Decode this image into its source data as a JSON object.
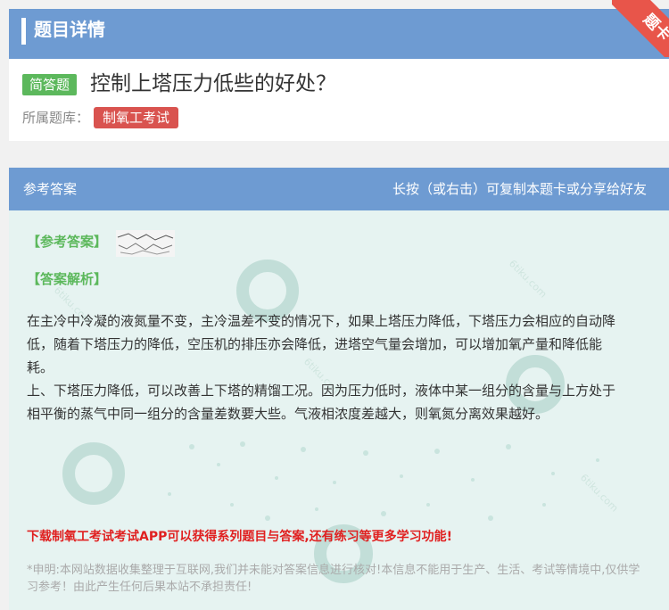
{
  "header": {
    "title": "题目详情"
  },
  "corner_badge": {
    "label": "题卡"
  },
  "question": {
    "type_badge": "简答题",
    "title": "控制上塔压力低些的好处？",
    "bank_label": "所属题库：",
    "bank_tag": "制氧工考试"
  },
  "answer_section": {
    "header_left": "参考答案",
    "header_right": "长按（或右击）可复制本题卡或分享给好友",
    "ref_answer_label": "【参考答案】",
    "analysis_label": "【答案解析】",
    "analysis_paragraphs": [
      "在主冷中冷凝的液氮量不变，主冷温差不变的情况下，如果上塔压力降低，下塔压力会相应的自动降低，随着下塔压力的降低，空压机的排压亦会降低，进塔空气量会增加，可以增加氧产量和降低能耗。",
      "上、下塔压力降低，可以改善上下塔的精馏工况。因为压力低时，液体中某一组分的含量与上方处于相平衡的蒸气中同一组分的含量差数要大些。气液相浓度差越大，则氧氮分离效果越好。"
    ]
  },
  "promo": {
    "text": "下载制氧工考试考试APP可以获得系列题目与答案,还有练习等更多学习功能!"
  },
  "disclaimer": {
    "text": "*申明:本网站数据收集整理于互联网,我们并未能对答案信息进行核对!本信息不能用于生产、生活、考试等情境中,仅供学习参考！由此产生任何后果本站不承担责任!"
  },
  "colors": {
    "header_blue": "#6e9bd2",
    "badge_green": "#5cb85c",
    "tag_red": "#d9534f",
    "ribbon_red": "#e8554a",
    "answer_bg": "#e6f3f1",
    "promo_red": "#e02020"
  }
}
